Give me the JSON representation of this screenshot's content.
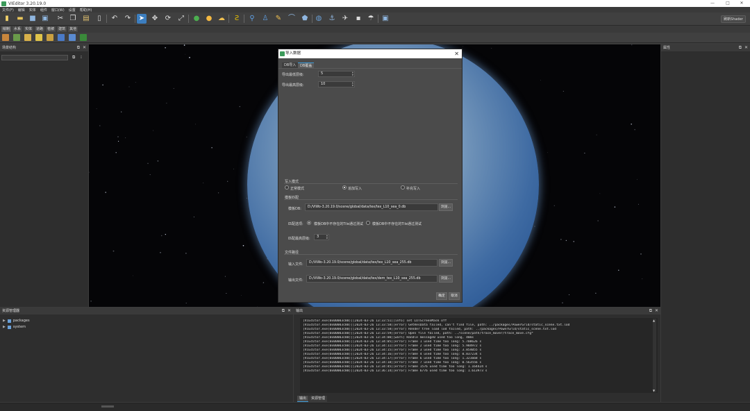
{
  "window": {
    "title": "VIEditor 3.20.19.0",
    "minimize": "—",
    "maximize": "□",
    "close": "✕"
  },
  "menu": [
    "文件(F)",
    "编辑",
    "实体",
    "组件",
    "窗口(W)",
    "设置",
    "帮助(H)"
  ],
  "toolbar": {
    "icons": [
      "new-file-icon",
      "open-folder-icon",
      "save-icon",
      "save-all-icon",
      "cut-icon",
      "copy-icon",
      "paste-icon",
      "delete-icon",
      "undo-icon",
      "redo-icon",
      "select-arrow-icon",
      "move-icon",
      "rotate-icon",
      "scale-icon",
      "globe-icon",
      "sun-icon",
      "weather-icon",
      "curve-icon",
      "pin-icon",
      "person-icon",
      "pencil-icon",
      "line-icon",
      "polygon-icon",
      "earth-icon",
      "anchor-icon",
      "plane-icon",
      "cube-icon",
      "umbrella-icon",
      "frame-icon"
    ],
    "shader_button": "刷新Shader"
  },
  "tabs": [
    "绘制",
    "水系",
    "实体",
    "道路",
    "植被",
    "建筑",
    "其他"
  ],
  "left_panel": {
    "title": "场景结构"
  },
  "right_panel": {
    "title": "属性"
  },
  "asset_panel": {
    "title": "资源管理器",
    "tree": [
      {
        "label": "packages"
      },
      {
        "label": "system"
      }
    ]
  },
  "output_panel": {
    "title": "输出",
    "lines": [
      "[ViEditor.exe(0x00003c80)][2024-03-26 13:33:51][info] set LUTScreenMask off",
      "[ViEditor.exe(0x00003c80)][2024-03-26 13:33:58][error] GetResData failed, can't find file, path: ../packages/PowerGrid/static_scene.txt.lod",
      "[ViEditor.exe(0x00003c80)][2024-03-26 13:33:58][error] Render tree load lod failed, path: ../packages/PowerGrid/static_scene.txt.lod",
      "[ViEditor.exe(0x00003c80)][2024-03-26 13:33:59][error] Open file failed, path: ../scene/path/trace_mover/trace_move.cfg*",
      "[ViEditor.exe(0x00003c80)][2024-03-26 13:34:00][warn] Handle message0 used too long, 48ms",
      "[ViEditor.exe(0x00003c80)][2024-03-26 13:34:05][error] Frame 1 used time too long: 5.708626 s",
      "[ViEditor.exe(0x00003c80)][2024-03-26 13:34:11][error] Frame 2 used time too long: 5.984972 s",
      "[ViEditor.exe(0x00003c80)][2024-03-26 13:34:15][error] Frame 3 used time too long: 3.854055 s",
      "[ViEditor.exe(0x00003c80)][2024-03-26 13:34:16][error] Frame 4 used time too long: 0.837234 s",
      "[ViEditor.exe(0x00003c80)][2024-03-26 13:34:17][error] Frame 6 used time too long: 1.321668 s",
      "[ViEditor.exe(0x00003c80)][2024-03-26 13:34:18][error] Frame 7 used time too long: 0.563556 s",
      "[ViEditor.exe(0x00003c80)][2024-03-26 13:34:45][error] Frame 1576 used time too long: 1.164424 s",
      "[ViEditor.exe(0x00003c80)][2024-03-26 13:36:14][error] Frame 6776 used time too long: 1.613973 s"
    ],
    "tabs": [
      "输出",
      "资源管理"
    ]
  },
  "dialog": {
    "title": "导入数据",
    "tabs": [
      "DB导入",
      "DB覆盖"
    ],
    "min_level_label": "导出最低层级:",
    "min_level": "5",
    "max_level_label": "导出最高层级:",
    "max_level": "10",
    "write_mode_label": "写入模式",
    "modes": [
      "正常模式",
      "追加写入",
      "补充写入"
    ],
    "template_label": "模板匹配",
    "template_file_label": "模板DB:",
    "template_file": "D:/ViWo-3.20.19.0/scene/global/data/tex/tex_L10_sea_0.db",
    "browse": "浏览...",
    "match_label": "匹配选项:",
    "match_options": [
      "模板DB中不存在的Tile通过测试",
      "模板DB中不存在的Tile通过测试"
    ],
    "matched_level_label": "匹配最高层级:",
    "matched_level": "3",
    "file_path_label": "文件路径",
    "input_label": "输入文件:",
    "input_file": "D:/ViWo-3.20.19.0/scene/global/data/tex/tex_L10_sea_255.db",
    "output_label": "输出文件:",
    "output_file": "D:/ViWo-3.20.19.0/scene/global/data/tex/dem_tex_L10_sea_255.db",
    "ok": "确定",
    "cancel": "取消"
  }
}
